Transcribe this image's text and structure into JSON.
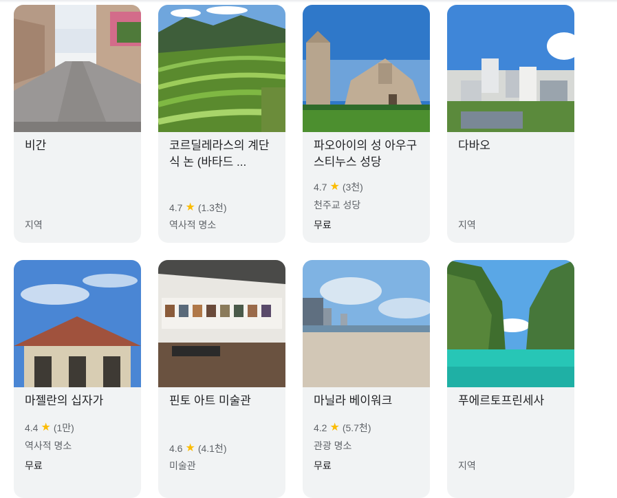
{
  "cards": [
    {
      "title": "비간",
      "rating": "",
      "reviews": "",
      "category": "지역",
      "price": ""
    },
    {
      "title": "코르딜레라스의 계단식 논 (바타드 ...",
      "rating": "4.7",
      "reviews": "(1.3천)",
      "category": "역사적 명소",
      "price": ""
    },
    {
      "title": "파오아이의 성 아우구스티누스 성당",
      "rating": "4.7",
      "reviews": "(3천)",
      "category": "천주교 성당",
      "price": "무료"
    },
    {
      "title": "다바오",
      "rating": "",
      "reviews": "",
      "category": "지역",
      "price": ""
    },
    {
      "title": "마젤란의 십자가",
      "rating": "4.4",
      "reviews": "(1만)",
      "category": "역사적 명소",
      "price": "무료"
    },
    {
      "title": "핀토 아트 미술관",
      "rating": "4.6",
      "reviews": "(4.1천)",
      "category": "미술관",
      "price": ""
    },
    {
      "title": "마닐라 베이워크",
      "rating": "4.2",
      "reviews": "(5.7천)",
      "category": "관광 명소",
      "price": "무료"
    },
    {
      "title": "푸에르토프린세사",
      "rating": "",
      "reviews": "",
      "category": "지역",
      "price": ""
    }
  ],
  "icons": {
    "star": "star-icon"
  },
  "colors": {
    "card_bg": "#f1f3f4",
    "star": "#fbbc04",
    "secondary_text": "#5f6368"
  }
}
